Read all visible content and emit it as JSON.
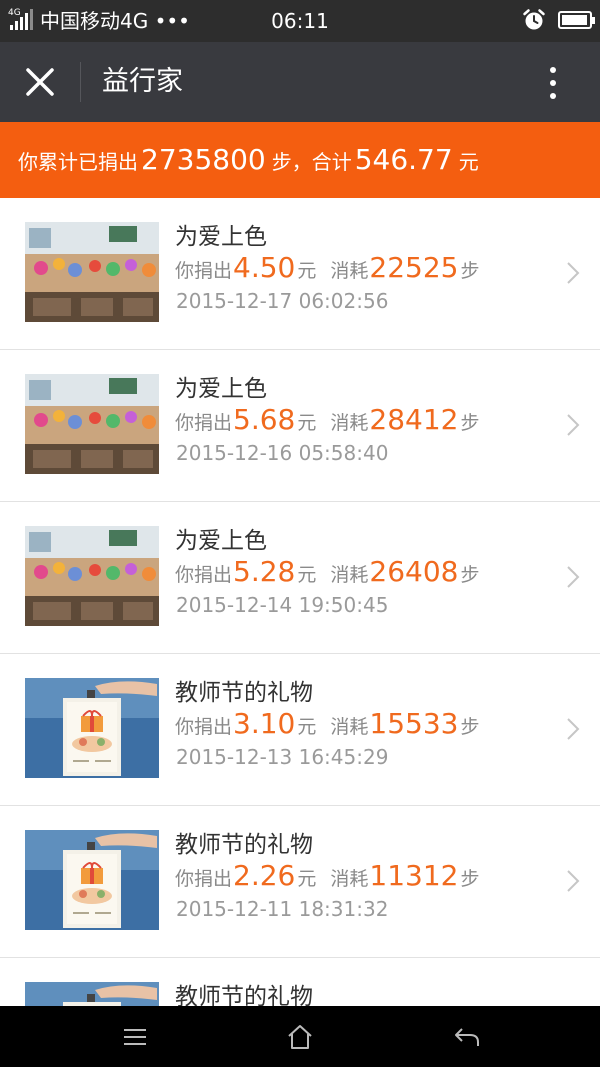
{
  "status_bar": {
    "network": "4G",
    "carrier": "中国移动4G ••• ",
    "time": "06:11",
    "signal_icon": "signal-bars-icon",
    "alarm_icon": "alarm-clock-icon",
    "battery_icon": "battery-icon",
    "battery_level_percent": 95
  },
  "title_bar": {
    "title": "益行家",
    "close_icon": "close-icon",
    "more_icon": "more-vertical-icon",
    "background": "#393a3f"
  },
  "summary": {
    "prefix": "你累计已捐出",
    "steps": "2735800",
    "steps_unit": "步，合计",
    "amount": "546.77",
    "amount_unit": "元",
    "background": "#f45e10"
  },
  "labels": {
    "donated": "你捐出",
    "yuan": "元",
    "consumed": "消耗",
    "steps": "步"
  },
  "donations": [
    {
      "project": "为爱上色",
      "amount": "4.50",
      "steps": "22525",
      "time": "2015-12-17 06:02:56",
      "thumbnail": "classroom-photo"
    },
    {
      "project": "为爱上色",
      "amount": "5.68",
      "steps": "28412",
      "time": "2015-12-16 05:58:40",
      "thumbnail": "classroom-photo"
    },
    {
      "project": "为爱上色",
      "amount": "5.28",
      "steps": "26408",
      "time": "2015-12-14 19:50:45",
      "thumbnail": "classroom-photo"
    },
    {
      "project": "教师节的礼物",
      "amount": "3.10",
      "steps": "15533",
      "time": "2015-12-13 16:45:29",
      "thumbnail": "gift-card-photo"
    },
    {
      "project": "教师节的礼物",
      "amount": "2.26",
      "steps": "11312",
      "time": "2015-12-11 18:31:32",
      "thumbnail": "gift-card-photo"
    },
    {
      "project": "教师节的礼物",
      "amount": "",
      "steps": "",
      "time": "",
      "thumbnail": "gift-card-photo"
    }
  ],
  "accent_color": "#f06a1e",
  "nav_bar": {
    "menu_icon": "menu-icon",
    "home_icon": "home-icon",
    "back_icon": "back-arrow-icon"
  }
}
